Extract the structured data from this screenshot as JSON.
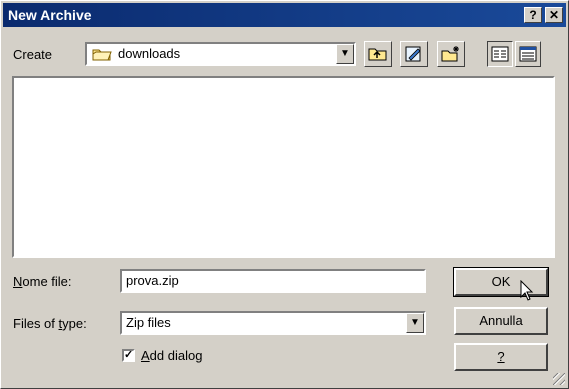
{
  "window": {
    "title": "New Archive",
    "help_glyph": "?",
    "close_glyph": "✕"
  },
  "toolbar": {
    "create_label": "Create",
    "folder": "downloads",
    "icons": [
      "folder-icon",
      "up-folder-icon",
      "edit-icon",
      "new-folder-icon",
      "list-view-icon",
      "details-view-icon"
    ]
  },
  "form": {
    "filename_label_ul": "N",
    "filename_label_rest": "ome file:",
    "filename_value": "prova.zip",
    "filetype_label_pre": "Files of ",
    "filetype_label_ul": "t",
    "filetype_label_rest": "ype:",
    "filetype_value": "Zip files",
    "add_dialog_ul": "A",
    "add_dialog_rest": "dd dialog",
    "add_dialog_checked": true
  },
  "buttons": {
    "ok": "OK",
    "cancel": "Annulla",
    "help": "?"
  },
  "colors": {
    "title_bar": "#0a2a6e",
    "accent_arrow": "#5b92c9",
    "background": "#c4d3e8"
  }
}
